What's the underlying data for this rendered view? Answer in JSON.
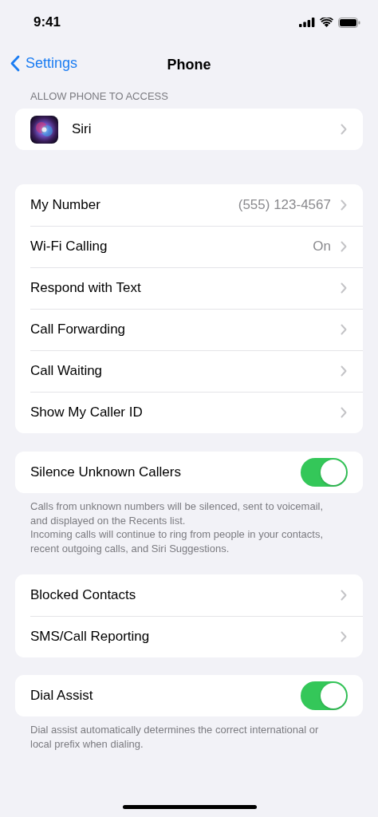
{
  "status_bar": {
    "time": "9:41"
  },
  "nav": {
    "back": "Settings",
    "title": "Phone"
  },
  "sections": [
    {
      "header": "ALLOW PHONE TO ACCESS",
      "rows": [
        {
          "kind": "app",
          "label": "Siri"
        }
      ]
    },
    {
      "rows": [
        {
          "kind": "link",
          "label": "My Number",
          "value": "(555) 123-4567"
        },
        {
          "kind": "link",
          "label": "Wi-Fi Calling",
          "value": "On"
        },
        {
          "kind": "link",
          "label": "Respond with Text"
        },
        {
          "kind": "link",
          "label": "Call Forwarding"
        },
        {
          "kind": "link",
          "label": "Call Waiting"
        },
        {
          "kind": "link",
          "label": "Show My Caller ID"
        }
      ]
    },
    {
      "rows": [
        {
          "kind": "toggle",
          "label": "Silence Unknown Callers",
          "on": true
        }
      ],
      "footer": [
        "Calls from unknown numbers will be silenced, sent to voicemail, and displayed on the Recents list.",
        "Incoming calls will continue to ring from people in your contacts, recent outgoing calls, and Siri Suggestions."
      ]
    },
    {
      "rows": [
        {
          "kind": "link",
          "label": "Blocked Contacts"
        },
        {
          "kind": "link",
          "label": "SMS/Call Reporting"
        }
      ]
    },
    {
      "rows": [
        {
          "kind": "toggle",
          "label": "Dial Assist",
          "on": true
        }
      ],
      "footer": [
        "Dial assist automatically determines the correct international or local prefix when dialing."
      ]
    }
  ]
}
